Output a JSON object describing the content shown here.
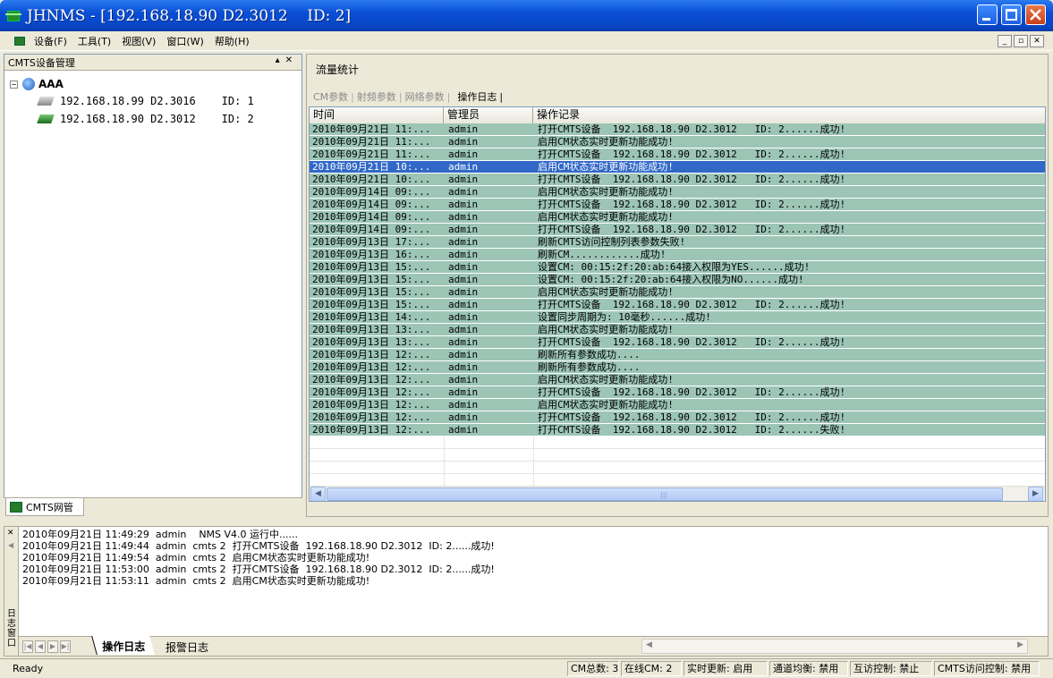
{
  "window": {
    "title": "JHNMS - [192.168.18.90 D2.3012    ID: 2]"
  },
  "menu": {
    "items": [
      "设备(F)",
      "工具(T)",
      "视图(V)",
      "窗口(W)",
      "帮助(H)"
    ]
  },
  "left": {
    "title": "CMTS设备管理",
    "tree": {
      "root": "AAA",
      "nodes": [
        "192.168.18.99 D2.3016    ID: 1",
        "192.168.18.90 D2.3012    ID: 2"
      ]
    },
    "tab": "CMTS网管"
  },
  "right": {
    "title": "流量统计",
    "tabs": [
      "CM参数",
      "射频参数",
      "网络参数",
      "操作日志"
    ],
    "active_tab": "操作日志",
    "table": {
      "headers": [
        "时间",
        "管理员",
        "操作记录"
      ],
      "selected_index": 3,
      "rows": [
        [
          "2010年09月21日 11:...",
          "admin",
          "打开CMTS设备  192.168.18.90 D2.3012   ID: 2......成功!"
        ],
        [
          "2010年09月21日 11:...",
          "admin",
          "启用CM状态实时更新功能成功!"
        ],
        [
          "2010年09月21日 11:...",
          "admin",
          "打开CMTS设备  192.168.18.90 D2.3012   ID: 2......成功!"
        ],
        [
          "2010年09月21日 10:...",
          "admin",
          "启用CM状态实时更新功能成功!"
        ],
        [
          "2010年09月21日 10:...",
          "admin",
          "打开CMTS设备  192.168.18.90 D2.3012   ID: 2......成功!"
        ],
        [
          "2010年09月14日 09:...",
          "admin",
          "启用CM状态实时更新功能成功!"
        ],
        [
          "2010年09月14日 09:...",
          "admin",
          "打开CMTS设备  192.168.18.90 D2.3012   ID: 2......成功!"
        ],
        [
          "2010年09月14日 09:...",
          "admin",
          "启用CM状态实时更新功能成功!"
        ],
        [
          "2010年09月14日 09:...",
          "admin",
          "打开CMTS设备  192.168.18.90 D2.3012   ID: 2......成功!"
        ],
        [
          "2010年09月13日 17:...",
          "admin",
          "刷新CMTS访问控制列表参数失败!"
        ],
        [
          "2010年09月13日 16:...",
          "admin",
          "刷新CM............成功!"
        ],
        [
          "2010年09月13日 15:...",
          "admin",
          "设置CM: 00:15:2f:20:ab:64接入权限为YES......成功!"
        ],
        [
          "2010年09月13日 15:...",
          "admin",
          "设置CM: 00:15:2f:20:ab:64接入权限为NO......成功!"
        ],
        [
          "2010年09月13日 15:...",
          "admin",
          "启用CM状态实时更新功能成功!"
        ],
        [
          "2010年09月13日 15:...",
          "admin",
          "打开CMTS设备  192.168.18.90 D2.3012   ID: 2......成功!"
        ],
        [
          "2010年09月13日 14:...",
          "admin",
          "设置同步周期为: 10毫秒......成功!"
        ],
        [
          "2010年09月13日 13:...",
          "admin",
          "启用CM状态实时更新功能成功!"
        ],
        [
          "2010年09月13日 13:...",
          "admin",
          "打开CMTS设备  192.168.18.90 D2.3012   ID: 2......成功!"
        ],
        [
          "2010年09月13日 12:...",
          "admin",
          "刷新所有参数成功...."
        ],
        [
          "2010年09月13日 12:...",
          "admin",
          "刷新所有参数成功...."
        ],
        [
          "2010年09月13日 12:...",
          "admin",
          "启用CM状态实时更新功能成功!"
        ],
        [
          "2010年09月13日 12:...",
          "admin",
          "打开CMTS设备  192.168.18.90 D2.3012   ID: 2......成功!"
        ],
        [
          "2010年09月13日 12:...",
          "admin",
          "启用CM状态实时更新功能成功!"
        ],
        [
          "2010年09月13日 12:...",
          "admin",
          "打开CMTS设备  192.168.18.90 D2.3012   ID: 2......成功!"
        ],
        [
          "2010年09月13日 12:...",
          "admin",
          "打开CMTS设备  192.168.18.90 D2.3012   ID: 2......失败!"
        ]
      ]
    }
  },
  "bottom": {
    "gutter_label": "日志窗口",
    "log": [
      "2010年09月21日 11:49:29  admin    NMS V4.0 运行中......",
      "2010年09月21日 11:49:44  admin  cmts 2  打开CMTS设备  192.168.18.90 D2.3012  ID: 2......成功!",
      "2010年09月21日 11:49:54  admin  cmts 2  启用CM状态实时更新功能成功!",
      "2010年09月21日 11:53:00  admin  cmts 2  打开CMTS设备  192.168.18.90 D2.3012  ID: 2......成功!",
      "2010年09月21日 11:53:11  admin  cmts 2  启用CM状态实时更新功能成功!"
    ],
    "tabs": [
      "操作日志",
      "报警日志"
    ]
  },
  "status": {
    "ready": "Ready",
    "panels": [
      "CM总数: 3",
      "在线CM: 2",
      "实时更新: 启用",
      "通道均衡: 禁用",
      "互访控制: 禁止",
      "CMTS访问控制: 禁用"
    ]
  },
  "colors": {
    "row_bg": "#9cc5b6",
    "row_selected": "#3168c8",
    "titlebar": "#0a4fd6"
  },
  "icons": [
    "app-icon",
    "globe-icon",
    "device-gray-icon",
    "device-green-icon",
    "network-icon"
  ]
}
